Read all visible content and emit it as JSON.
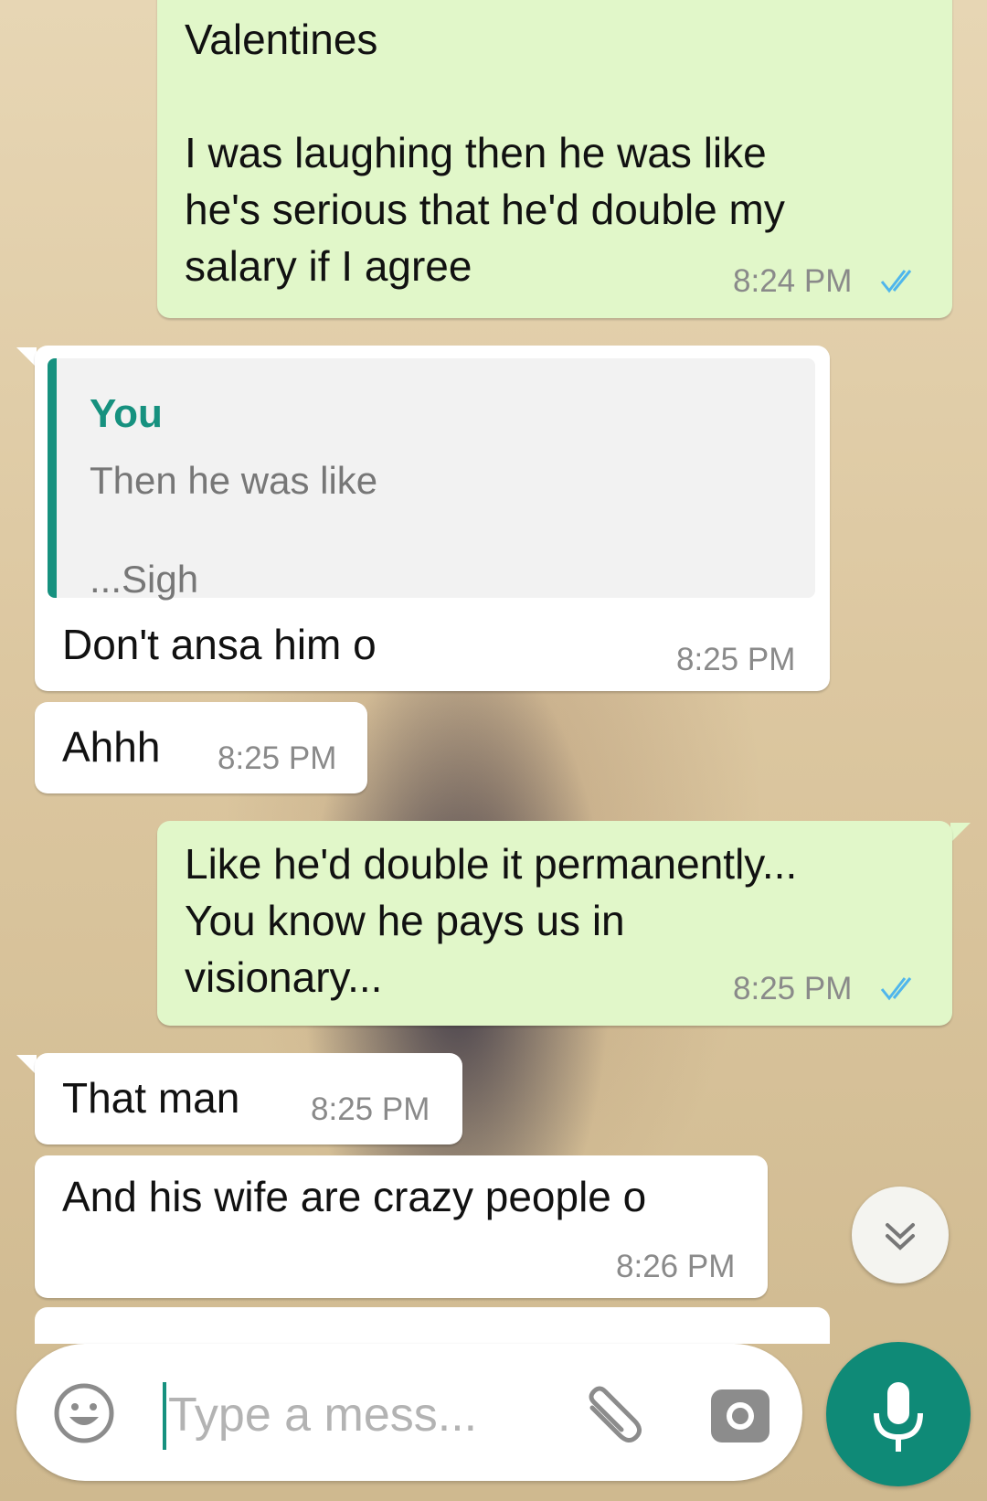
{
  "messages": [
    {
      "direction": "outgoing",
      "text": "Valentines\n\nI was laughing then he was like\nhe's serious that he'd double my\nsalary if I agree",
      "time": "8:24 PM",
      "status": "read-double-check-icon"
    },
    {
      "direction": "incoming",
      "quote": {
        "author": "You",
        "text": "Then he was like\n...Sigh"
      },
      "text": "Don't ansa him o",
      "time": "8:25 PM"
    },
    {
      "direction": "incoming",
      "text": "Ahhh",
      "time": "8:25 PM"
    },
    {
      "direction": "outgoing",
      "text": "Like he'd double it permanently...\nYou know he pays us in\nvisionary...",
      "time": "8:25 PM",
      "status": "read-double-check-icon"
    },
    {
      "direction": "incoming",
      "text": "That man",
      "time": "8:25 PM"
    },
    {
      "direction": "incoming",
      "text": "And his wife are crazy people o",
      "time": "8:26 PM"
    }
  ],
  "composer": {
    "placeholder": "Type a mess...",
    "icons": [
      "emoji-icon",
      "attach-icon",
      "camera-icon",
      "mic-icon"
    ]
  },
  "scroll_down_icon": "double-chevron-down-icon",
  "colors": {
    "outgoing_bubble": "#e1f7c9",
    "incoming_bubble": "#ffffff",
    "accent": "#16917f",
    "mic_button": "#0f8a77",
    "read_ticks": "#4fb6ec"
  }
}
